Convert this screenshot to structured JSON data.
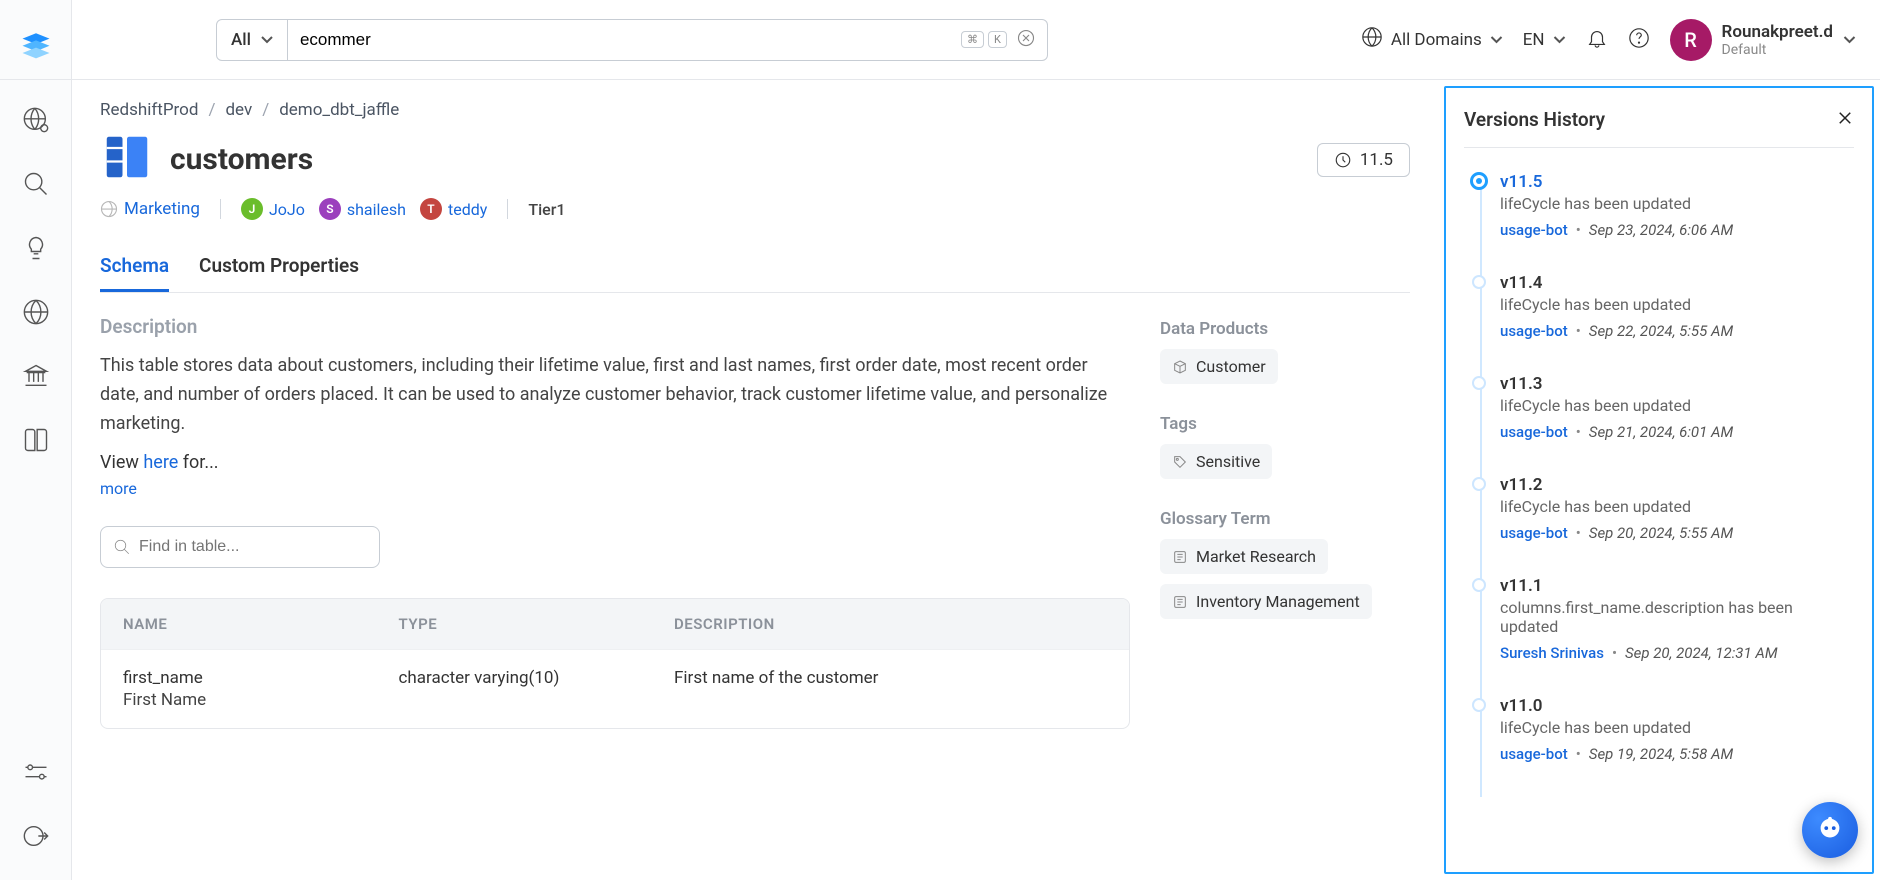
{
  "topbar": {
    "search_scope": "All",
    "search_value": "ecommer",
    "kbd1": "⌘",
    "kbd2": "K",
    "domains_label": "All Domains",
    "lang_label": "EN"
  },
  "user": {
    "initial": "R",
    "name": "Rounakpreet.d",
    "role": "Default"
  },
  "breadcrumb": [
    "RedshiftProd",
    "dev",
    "demo_dbt_jaffle"
  ],
  "version_button": "11.5",
  "page_title": "customers",
  "domain_chip": "Marketing",
  "owners": [
    {
      "initial": "J",
      "name": "JoJo",
      "color": "#6abd2b"
    },
    {
      "initial": "S",
      "name": "shailesh",
      "color": "#9b3fbd"
    },
    {
      "initial": "T",
      "name": "teddy",
      "color": "#c4453f"
    }
  ],
  "tier": "Tier1",
  "tabs": [
    "Schema",
    "Custom Properties"
  ],
  "description": {
    "heading": "Description",
    "text": "This table stores data about customers, including their lifetime value, first and last names, first order date, most recent order date, and number of orders placed. It can be used to analyze customer behavior, track customer lifetime value, and personalize marketing.",
    "view_prefix": "View ",
    "view_link": "here",
    "view_suffix": " for...",
    "more": "more"
  },
  "find_placeholder": "Find in table...",
  "table": {
    "headers": [
      "NAME",
      "TYPE",
      "DESCRIPTION"
    ],
    "rows": [
      {
        "name": "first_name",
        "label": "First Name",
        "type": "character varying(10)",
        "desc": "First name of the customer"
      }
    ]
  },
  "side_info": {
    "data_products_h": "Data Products",
    "data_products": [
      "Customer"
    ],
    "tags_h": "Tags",
    "tags": [
      "Sensitive"
    ],
    "glossary_h": "Glossary Term",
    "glossary": [
      "Market Research",
      "Inventory Management"
    ]
  },
  "versions": {
    "title": "Versions History",
    "items": [
      {
        "ver": "v11.5",
        "desc": "lifeCycle has been updated",
        "user": "usage-bot",
        "time": "Sep 23, 2024, 6:06 AM",
        "active": true
      },
      {
        "ver": "v11.4",
        "desc": "lifeCycle has been updated",
        "user": "usage-bot",
        "time": "Sep 22, 2024, 5:55 AM"
      },
      {
        "ver": "v11.3",
        "desc": "lifeCycle has been updated",
        "user": "usage-bot",
        "time": "Sep 21, 2024, 6:01 AM"
      },
      {
        "ver": "v11.2",
        "desc": "lifeCycle has been updated",
        "user": "usage-bot",
        "time": "Sep 20, 2024, 5:55 AM"
      },
      {
        "ver": "v11.1",
        "desc": "columns.first_name.description has been updated",
        "user": "Suresh Srinivas",
        "time": "Sep 20, 2024, 12:31 AM"
      },
      {
        "ver": "v11.0",
        "desc": "lifeCycle has been updated",
        "user": "usage-bot",
        "time": "Sep 19, 2024, 5:58 AM"
      }
    ]
  }
}
